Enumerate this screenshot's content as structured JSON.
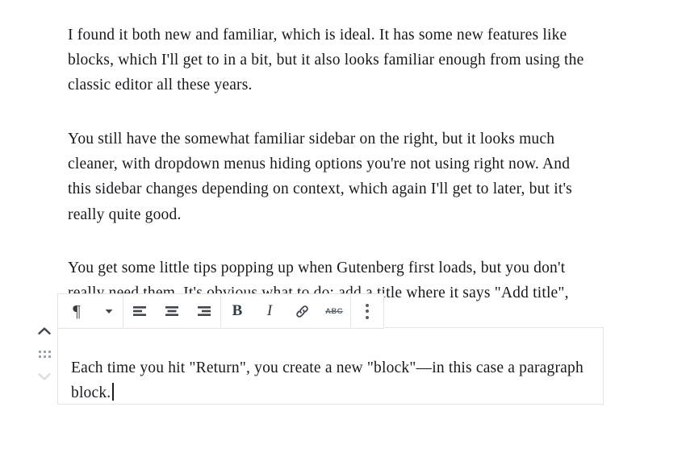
{
  "editor": {
    "paragraphs": [
      "I found it both new and familiar, which is ideal. It has some new features like blocks, which I'll get to in a bit, but it also looks familiar enough from using the classic editor all these years.",
      "You still have the somewhat familiar sidebar on the right, but it looks much cleaner, with dropdown menus hiding options you're not using right now. And this sidebar changes depending on context, which again I'll get to later, but it's really quite good.",
      "You get some little tips popping up when Gutenberg first loads, but you don't really need them. It's obvious what to do: add a title where it says \"Add title\", then start writing underneath."
    ],
    "selected_block": {
      "text": "Each time you hit \"Return\", you create a new \"block\"—in this case a paragraph block.",
      "caret_visible": true
    }
  },
  "block_mover": {
    "move_up_label": "Move up",
    "drag_label": "Drag",
    "move_down_label": "Move down",
    "move_up_icon": "chevron-up-icon",
    "drag_icon": "drag-handle-icon",
    "move_down_icon": "chevron-down-icon"
  },
  "toolbar": {
    "block_type": {
      "label": "Paragraph",
      "glyph": "¶",
      "icon": "paragraph-icon",
      "dropdown_icon": "chevron-down-icon"
    },
    "alignment": [
      {
        "label": "Align left",
        "icon": "align-left-icon"
      },
      {
        "label": "Align center",
        "icon": "align-center-icon"
      },
      {
        "label": "Align right",
        "icon": "align-right-icon"
      }
    ],
    "formatting": [
      {
        "label": "Bold",
        "icon": "bold-icon",
        "glyph": "B"
      },
      {
        "label": "Italic",
        "icon": "italic-icon",
        "glyph": "I"
      },
      {
        "label": "Link",
        "icon": "link-icon"
      },
      {
        "label": "Strikethrough",
        "icon": "strikethrough-icon",
        "glyph": "ABC"
      }
    ],
    "more": {
      "label": "More options",
      "icon": "kebab-menu-icon"
    }
  },
  "colors": {
    "text": "#16191d",
    "border": "#e2e4e7",
    "icon": "#40464d",
    "icon_muted": "#9ba2ab",
    "background": "#ffffff"
  }
}
